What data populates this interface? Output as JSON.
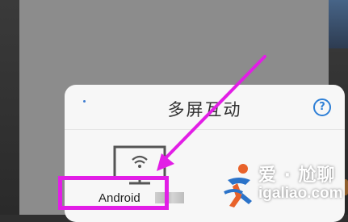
{
  "dialog": {
    "title": "多屏互动",
    "help_icon": "question-circle-icon",
    "device": {
      "name": "Android",
      "icon": "tv-wifi-icon"
    }
  },
  "annotation": {
    "color": "#e21ee6"
  },
  "watermark": {
    "line1": "爱 · 尬聊",
    "line2": "igaliao.com",
    "logo": "running-figure-logo"
  },
  "colors": {
    "accent": "#2e7fd6",
    "sheet": "#f7f7f7",
    "backdrop": "#8c8c8c"
  }
}
